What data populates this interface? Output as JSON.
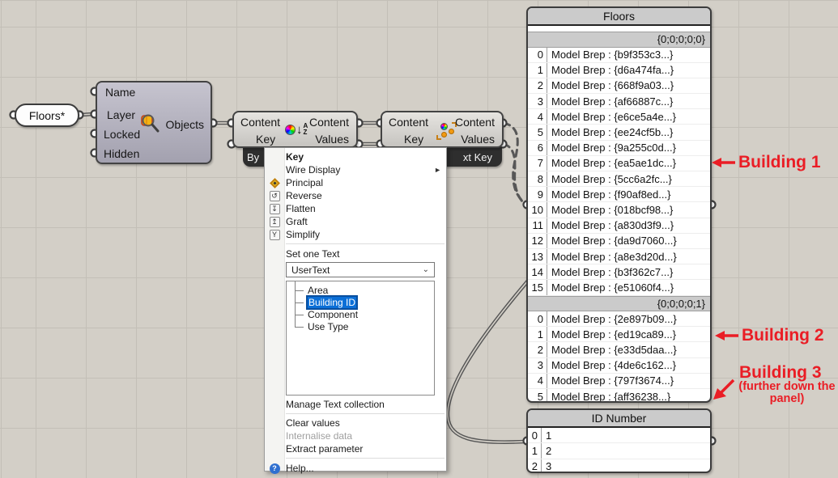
{
  "param_floors": {
    "label": "Floors*"
  },
  "model_component": {
    "icon": "model-object-magnifier-icon",
    "inputs": [
      "Name",
      "Layer",
      "Locked",
      "Hidden"
    ],
    "output": "Objects"
  },
  "sort_component": {
    "icon": "sort-content-az-icon",
    "inputs": [
      "Content",
      "Key"
    ],
    "outputs": [
      "Content",
      "Values"
    ],
    "tag": "By"
  },
  "pick_component": {
    "icon": "pick-content-icon",
    "inputs": [
      "Content",
      "Key"
    ],
    "outputs": [
      "Content",
      "Values"
    ],
    "tag": "xt Key"
  },
  "context_menu": {
    "items": [
      {
        "label": "Key",
        "bold": true
      },
      {
        "label": "Wire Display",
        "submenu": true
      },
      {
        "label": "Principal",
        "icon": "principal-icon"
      },
      {
        "label": "Reverse",
        "icon": "reverse-icon",
        "glyph": "↺"
      },
      {
        "label": "Flatten",
        "icon": "flatten-icon",
        "glyph": "↧"
      },
      {
        "label": "Graft",
        "icon": "graft-icon",
        "glyph": "↥"
      },
      {
        "label": "Simplify",
        "icon": "simplify-icon",
        "glyph": "Y"
      }
    ],
    "set_one_text_label": "Set one Text",
    "dropdown_value": "UserText",
    "tree_items": [
      {
        "label": "Area",
        "selected": false
      },
      {
        "label": "Building ID",
        "selected": true
      },
      {
        "label": "Component",
        "selected": false
      },
      {
        "label": "Use Type",
        "selected": false
      }
    ],
    "manage_label": "Manage Text collection",
    "bottom_items": [
      {
        "label": "Clear values",
        "disabled": false
      },
      {
        "label": "Internalise data",
        "disabled": true
      },
      {
        "label": "Extract parameter",
        "disabled": false
      }
    ],
    "help_label": "Help..."
  },
  "floors_panel": {
    "title": "Floors",
    "groups": [
      {
        "path": "{0;0;0;0;0}",
        "items": [
          "Model Brep : {b9f353c3...}",
          "Model Brep : {d6a474fa...}",
          "Model Brep : {668f9a03...}",
          "Model Brep : {af66887c...}",
          "Model Brep : {e6ce5a4e...}",
          "Model Brep : {ee24cf5b...}",
          "Model Brep : {9a255c0d...}",
          "Model Brep : {ea5ae1dc...}",
          "Model Brep : {5cc6a2fc...}",
          "Model Brep : {f90af8ed...}",
          "Model Brep : {018bcf98...}",
          "Model Brep : {a830d3f9...}",
          "Model Brep : {da9d7060...}",
          "Model Brep : {a8e3d20d...}",
          "Model Brep : {b3f362c7...}",
          "Model Brep : {e51060f4...}"
        ]
      },
      {
        "path": "{0;0;0;0;1}",
        "items": [
          "Model Brep : {2e897b09...}",
          "Model Brep : {ed19ca89...}",
          "Model Brep : {e33d5daa...}",
          "Model Brep : {4de6c162...}",
          "Model Brep : {797f3674...}",
          "Model Brep : {aff36238...}"
        ]
      }
    ]
  },
  "id_panel": {
    "title": "ID Number",
    "items": [
      "1",
      "2",
      "3"
    ]
  },
  "annotations": {
    "color": "#ea1d25",
    "building1": "Building 1",
    "building2": "Building 2",
    "building3": "Building 3",
    "building3_note": "(further down the panel)"
  }
}
